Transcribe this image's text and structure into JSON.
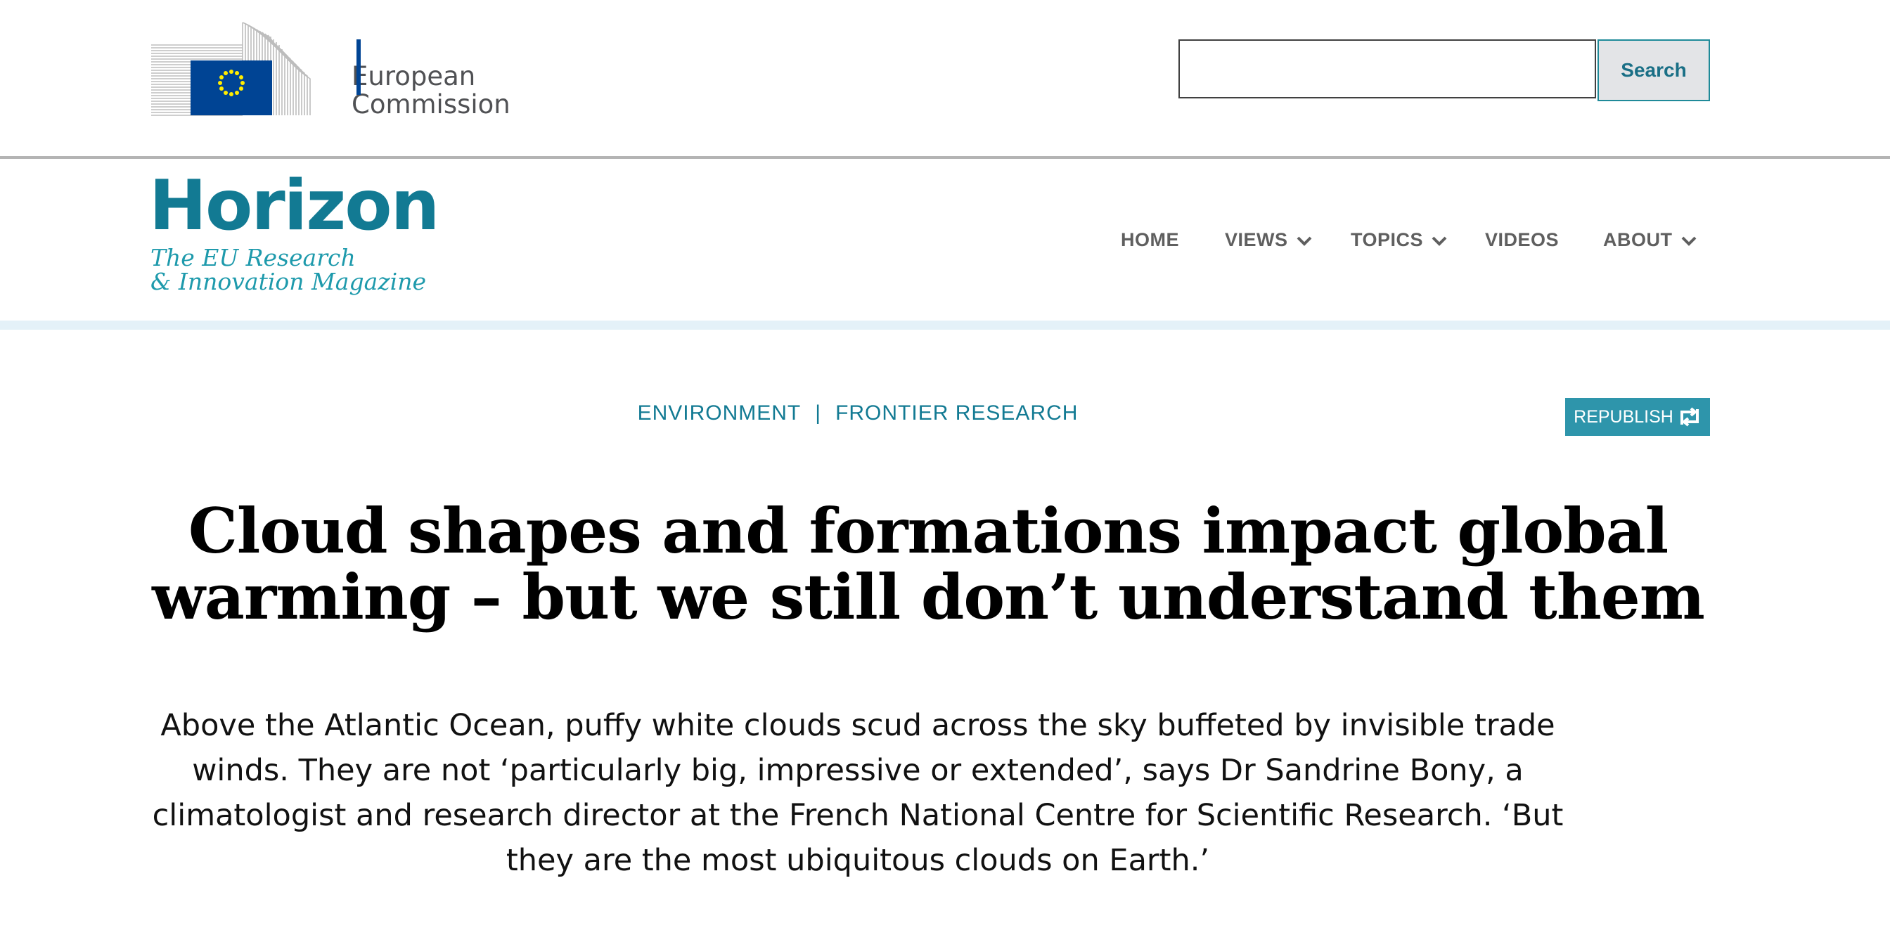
{
  "ec_header": {
    "logo_line1": "European",
    "logo_line2": "Commission",
    "search_placeholder": "",
    "search_button_label": "Search"
  },
  "brand": {
    "title": "Horizon",
    "subtitle_line1": "The EU Research",
    "subtitle_line2": "& Innovation Magazine"
  },
  "nav": {
    "items": [
      {
        "label": "HOME",
        "has_dropdown": false
      },
      {
        "label": "VIEWS",
        "has_dropdown": true
      },
      {
        "label": "TOPICS",
        "has_dropdown": true
      },
      {
        "label": "VIDEOS",
        "has_dropdown": false
      },
      {
        "label": "ABOUT",
        "has_dropdown": true
      }
    ]
  },
  "article": {
    "categories": [
      "ENVIRONMENT",
      "FRONTIER RESEARCH"
    ],
    "category_separator": "|",
    "republish_label": "REPUBLISH",
    "title": "Cloud shapes and formations impact global warming – but we still don’t understand them",
    "lead": "Above the Atlantic Ocean, puffy white clouds scud across the sky buffeted by invisible trade winds. They are not ‘particularly big, impressive or extended’, says Dr Sandrine Bony, a climatologist and research director at the French National Centre for Scientific Research. ‘But they are the most ubiquitous clouds on Earth.’"
  },
  "colors": {
    "brand_teal": "#127a93",
    "brand_teal_light": "#1e9aac",
    "republish_bg": "#2e95ab",
    "eu_blue": "#004494",
    "eu_star_yellow": "#ffed00"
  },
  "icons": {
    "chevron": "chevron-down-icon",
    "republish": "republish-icon",
    "eu_flag": "eu-flag-icon"
  }
}
